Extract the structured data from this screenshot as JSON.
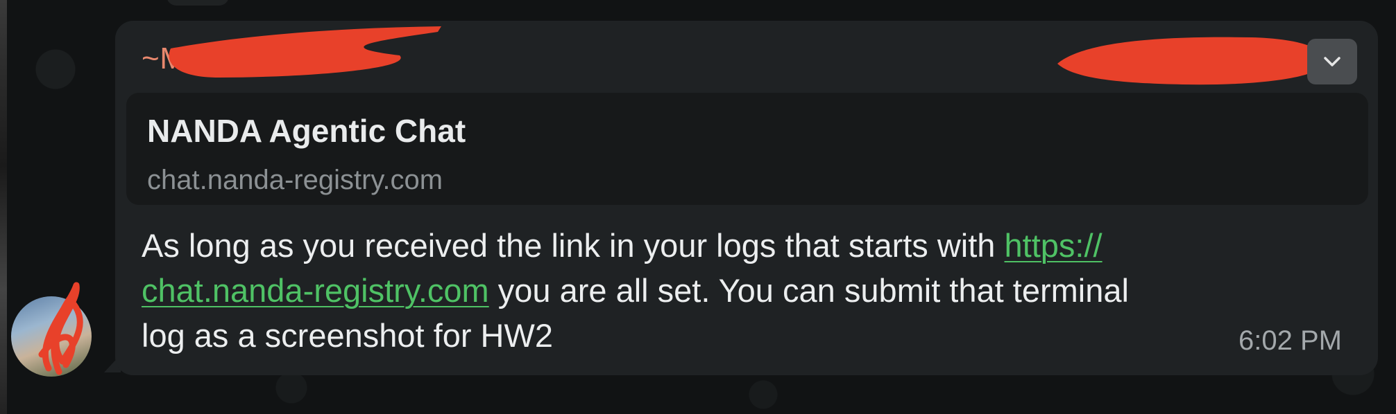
{
  "message": {
    "sender_name": "~M",
    "link_preview": {
      "title": "NANDA Agentic Chat",
      "domain": "chat.nanda-registry.com"
    },
    "body": {
      "line1_text": "As long as you received the link in your logs that starts with ",
      "link_part1": "https://",
      "link_part2": "chat.nanda-registry.com",
      "line2_text": " you are all set. You can submit that terminal",
      "line3_text": "log as a screenshot for HW2"
    },
    "timestamp": "6:02 PM"
  },
  "icons": {
    "menu": "chevron-down-icon"
  },
  "colors": {
    "sender": "#e8886e",
    "link": "#4fc265",
    "bubble": "#1f2224",
    "preview_bg": "#17191a",
    "redaction": "#e8412a"
  }
}
